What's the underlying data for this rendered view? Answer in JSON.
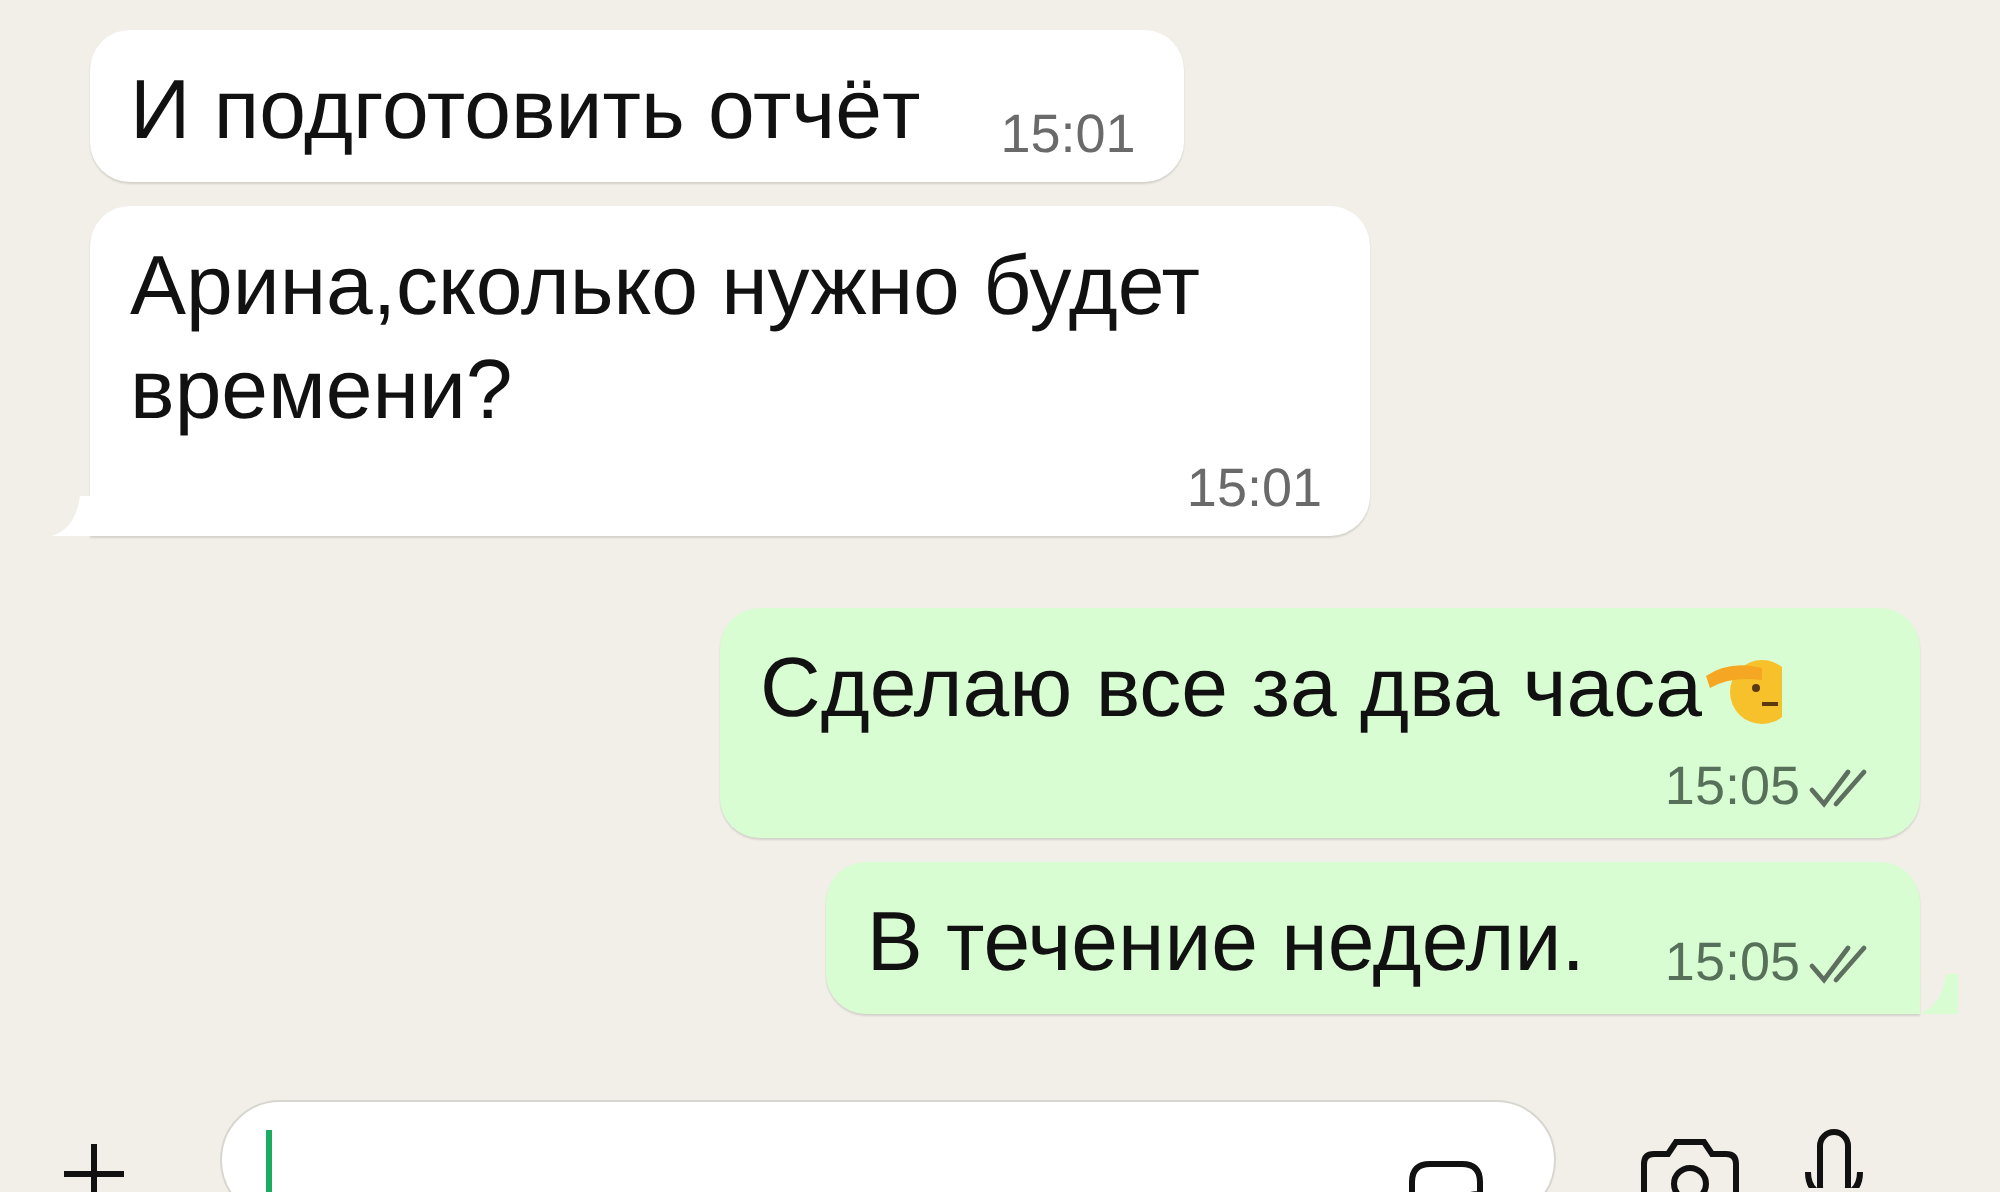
{
  "messages": [
    {
      "kind": "incoming",
      "text": "И подготовить отчёт",
      "time": "15:01",
      "tail": false
    },
    {
      "kind": "incoming",
      "text": "Арина,сколько нужно будет\nвремени?",
      "time": "15:01",
      "tail": true
    },
    {
      "kind": "outgoing",
      "text": "Сделаю все за два часа",
      "time": "15:05",
      "tail": false,
      "emoji": true,
      "read": false
    },
    {
      "kind": "outgoing",
      "text": "В течение недели.",
      "time": "15:05",
      "tail": true,
      "read": false
    }
  ],
  "composer": {
    "caret": true
  }
}
